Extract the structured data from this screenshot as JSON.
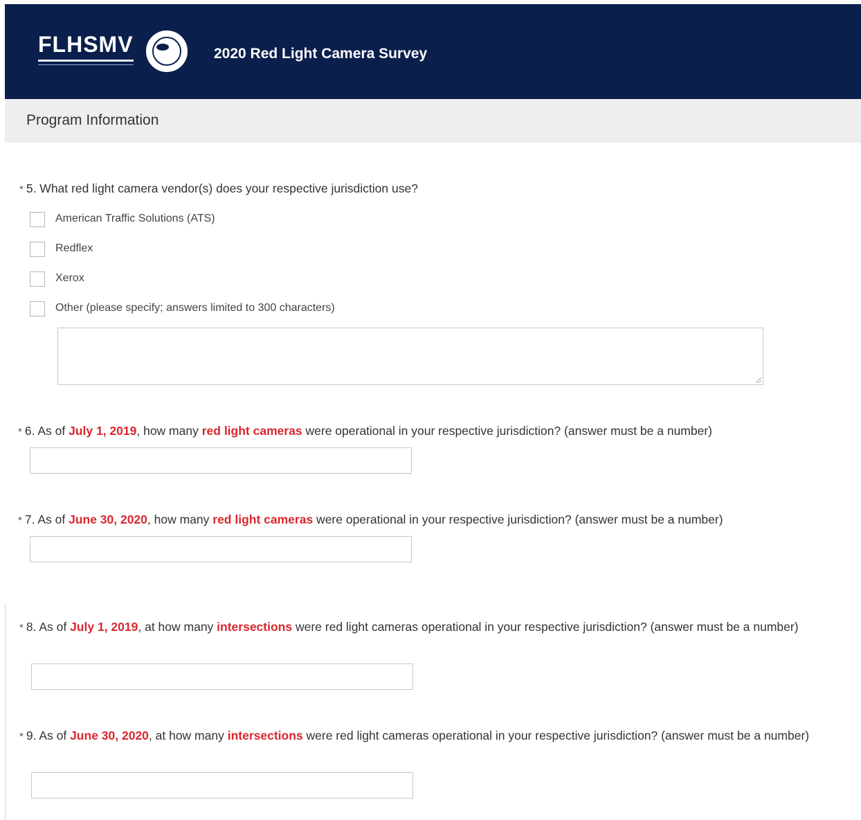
{
  "header": {
    "logo_text": "FLHSMV",
    "survey_title": "2020 Red Light Camera Survey",
    "seal_icon": "florida-highway-patrol-seal-icon",
    "background": "#0b1f4d"
  },
  "page": {
    "title": "Program Information"
  },
  "accent_color": "#d9272e",
  "questions": {
    "q5": {
      "required_mark": "*",
      "text": "5. What red light camera vendor(s) does your respective jurisdiction use?",
      "options": [
        "American Traffic Solutions (ATS)",
        "Redflex",
        "Xerox",
        "Other (please specify; answers limited to 300 characters)"
      ],
      "other_value": ""
    },
    "q6": {
      "required_mark": "*",
      "pre": "6. As of ",
      "date": "July 1, 2019",
      "mid": ", how many ",
      "subject": "red light cameras",
      "post": " were operational in your respective jurisdiction? (answer must be a number)",
      "value": ""
    },
    "q7": {
      "required_mark": "*",
      "pre": "7. As of ",
      "date": "June 30, 2020",
      "mid": ", how many ",
      "subject": "red light cameras",
      "post": " were operational in your respective jurisdiction? (answer must be a number)",
      "value": ""
    },
    "q8": {
      "required_mark": "*",
      "pre": "8. As of ",
      "date": "July 1, 2019",
      "mid": ", at how many ",
      "subject": "intersections",
      "post": " were red light cameras operational in your respective jurisdiction? (answer must be a number)",
      "value": ""
    },
    "q9": {
      "required_mark": "*",
      "pre": "9. As of ",
      "date": "June 30, 2020",
      "mid": ", at how many ",
      "subject": "intersections",
      "post": " were red light cameras operational in your respective jurisdiction? (answer must be a number)",
      "value": ""
    }
  }
}
